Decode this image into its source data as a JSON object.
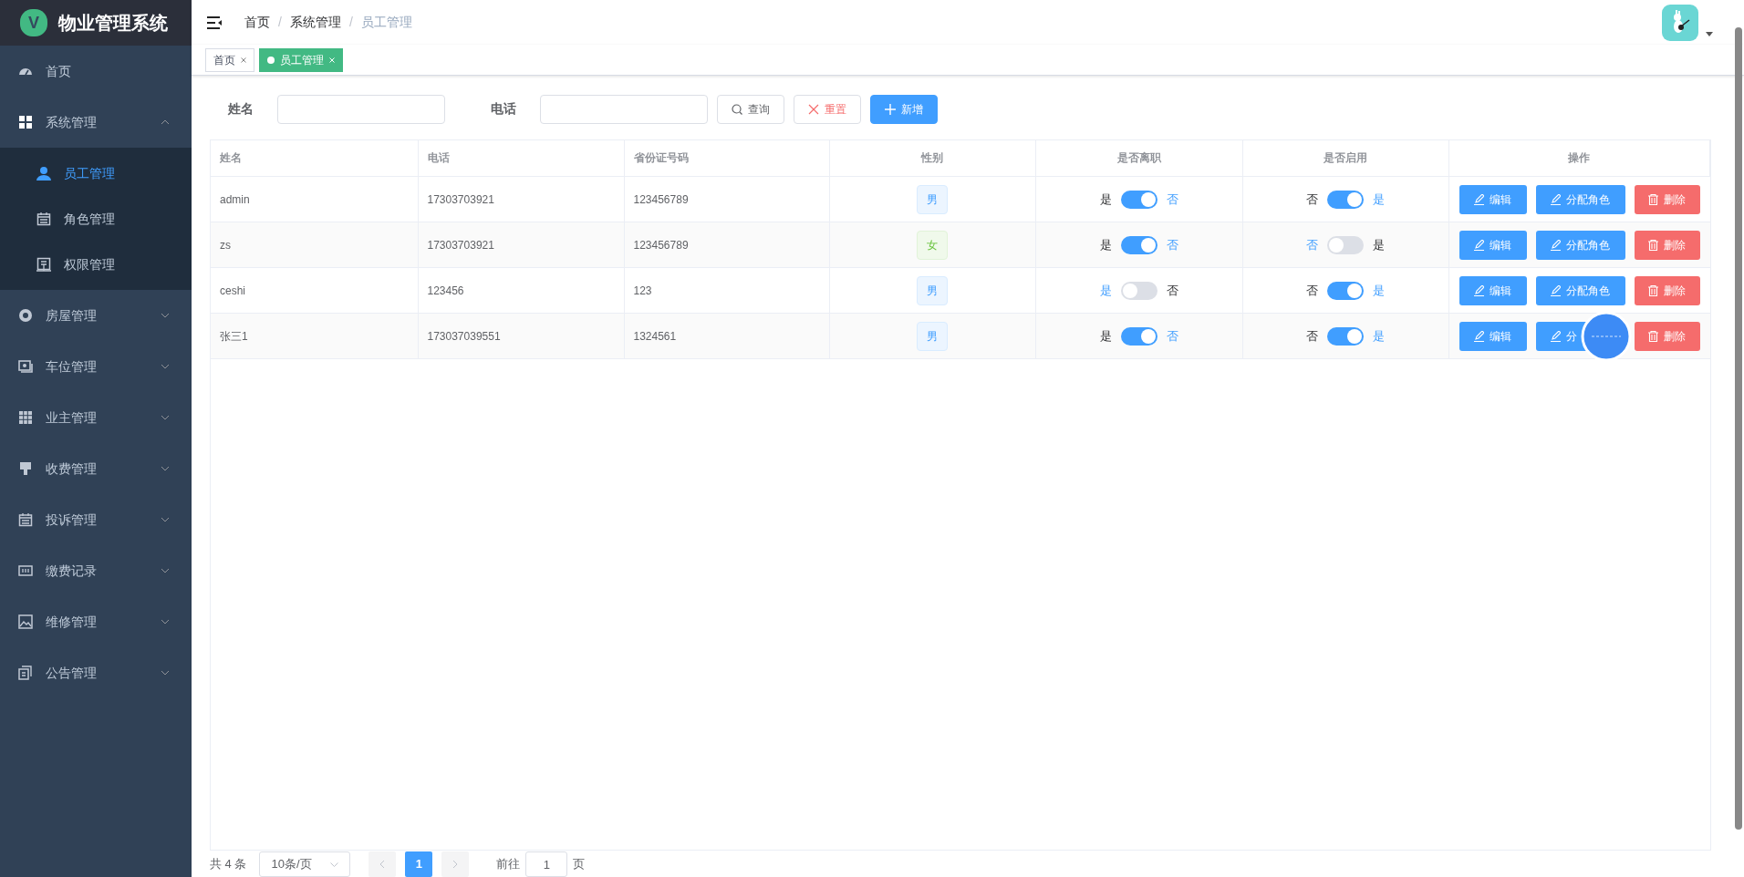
{
  "sidebar": {
    "title": "物业管理系统",
    "logo_letter": "V",
    "items": [
      {
        "label": "首页",
        "selected": false
      },
      {
        "label": "系统管理",
        "selected": false,
        "expanded": true,
        "children": [
          {
            "label": "员工管理",
            "selected": true
          },
          {
            "label": "角色管理",
            "selected": false
          },
          {
            "label": "权限管理",
            "selected": false
          }
        ]
      },
      {
        "label": "房屋管理",
        "selected": false,
        "expanded": false
      },
      {
        "label": "车位管理",
        "selected": false,
        "expanded": false
      },
      {
        "label": "业主管理",
        "selected": false,
        "expanded": false
      },
      {
        "label": "收费管理",
        "selected": false,
        "expanded": false
      },
      {
        "label": "投诉管理",
        "selected": false,
        "expanded": false
      },
      {
        "label": "缴费记录",
        "selected": false,
        "expanded": false
      },
      {
        "label": "维修管理",
        "selected": false,
        "expanded": false
      },
      {
        "label": "公告管理",
        "selected": false,
        "expanded": false
      }
    ]
  },
  "breadcrumb": [
    "首页",
    "系统管理",
    "员工管理"
  ],
  "breadcrumb_separator": "/",
  "tabs": [
    {
      "label": "首页",
      "selected": false
    },
    {
      "label": "员工管理",
      "selected": true
    }
  ],
  "filters": [
    {
      "label": "姓名"
    },
    {
      "label": "电话"
    }
  ],
  "filter_buttons": [
    {
      "label": "查询",
      "kind": "default"
    },
    {
      "label": "重置",
      "kind": "danger"
    },
    {
      "label": "新增",
      "kind": "primary"
    }
  ],
  "table": {
    "columns": [
      "姓名",
      "电话",
      "省份证号码",
      "性别",
      "是否离职",
      "是否启用",
      "操作"
    ],
    "rows": [
      {
        "name": "admin",
        "phone": "17303703921",
        "id_number": "123456789",
        "gender": {
          "label": "男",
          "kind": "male"
        },
        "resigned": {
          "left": "是",
          "right": "否",
          "on": true
        },
        "enabled": {
          "left": "否",
          "right": "是",
          "on": true
        },
        "actions": [
          {
            "label": "编辑",
            "kind": "edit"
          },
          {
            "label": "分配角色",
            "kind": "edit"
          },
          {
            "label": "删除",
            "kind": "delete"
          }
        ]
      },
      {
        "name": "zs",
        "phone": "17303703921",
        "id_number": "123456789",
        "gender": {
          "label": "女",
          "kind": "female"
        },
        "resigned": {
          "left": "是",
          "right": "否",
          "on": true
        },
        "enabled": {
          "left": "否",
          "right": "是",
          "on": false
        },
        "actions": [
          {
            "label": "编辑",
            "kind": "edit"
          },
          {
            "label": "分配角色",
            "kind": "edit"
          },
          {
            "label": "删除",
            "kind": "delete"
          }
        ]
      },
      {
        "name": "ceshi",
        "phone": "123456",
        "id_number": "123",
        "gender": {
          "label": "男",
          "kind": "male"
        },
        "resigned": {
          "left": "是",
          "right": "否",
          "on": false
        },
        "enabled": {
          "left": "否",
          "right": "是",
          "on": true
        },
        "actions": [
          {
            "label": "编辑",
            "kind": "edit"
          },
          {
            "label": "分配角色",
            "kind": "edit"
          },
          {
            "label": "删除",
            "kind": "delete"
          }
        ]
      },
      {
        "name": "张三1",
        "phone": "173037039551",
        "id_number": "1324561",
        "gender": {
          "label": "男",
          "kind": "male"
        },
        "resigned": {
          "left": "是",
          "right": "否",
          "on": true
        },
        "enabled": {
          "left": "否",
          "right": "是",
          "on": true
        },
        "actions": [
          {
            "label": "编辑",
            "kind": "edit"
          },
          {
            "label": "分",
            "kind": "edit"
          },
          {
            "label": "删除",
            "kind": "delete"
          }
        ]
      }
    ]
  },
  "pagination": {
    "total": "共 4 条",
    "page_size": "10条/页",
    "pages": [
      {
        "label": "1",
        "selected": true
      }
    ],
    "goto_label": "前往",
    "goto_value": "1",
    "goto_suffix": "页"
  }
}
